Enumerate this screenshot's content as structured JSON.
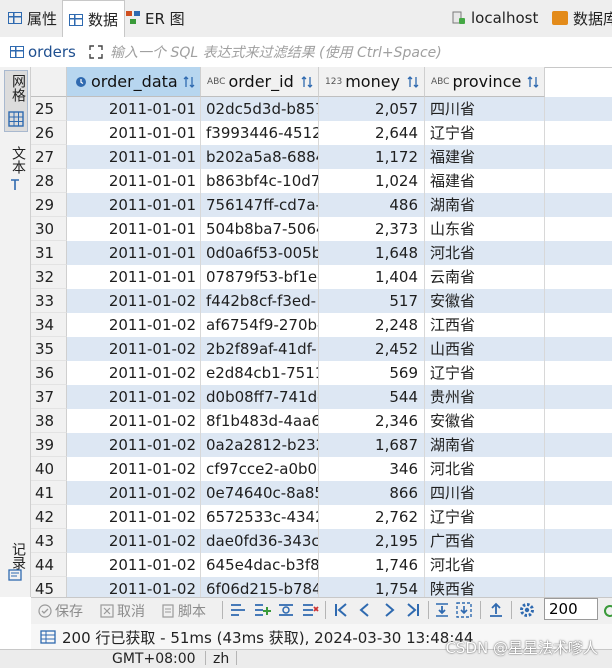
{
  "tabs": [
    {
      "label": "属性",
      "icon": "properties-table-icon"
    },
    {
      "label": "数据",
      "icon": "data-grid-icon",
      "active": true
    },
    {
      "label": "ER 图",
      "icon": "er-diagram-icon"
    }
  ],
  "connection": {
    "host": "localhost",
    "database_label": "数据库"
  },
  "filter": {
    "table": "orders",
    "placeholder": "输入一个 SQL 表达式来过滤结果 (使用 Ctrl+Space)"
  },
  "side_panels": [
    "网格",
    "文本",
    "记录"
  ],
  "columns": [
    {
      "name": "order_data",
      "type_badge": "🕑",
      "kind": "date"
    },
    {
      "name": "order_id",
      "type_badge": "ABC",
      "kind": "text"
    },
    {
      "name": "money",
      "type_badge": "123",
      "kind": "number"
    },
    {
      "name": "province",
      "type_badge": "ABC",
      "kind": "text"
    }
  ],
  "rows": [
    {
      "num": "25",
      "order_data": "2011-01-01",
      "order_id": "02dc5d3d-b857",
      "money": "2,057",
      "province": "四川省"
    },
    {
      "num": "26",
      "order_data": "2011-01-01",
      "order_id": "f3993446-4512",
      "money": "2,644",
      "province": "辽宁省"
    },
    {
      "num": "27",
      "order_data": "2011-01-01",
      "order_id": "b202a5a8-6884",
      "money": "1,172",
      "province": "福建省"
    },
    {
      "num": "28",
      "order_data": "2011-01-01",
      "order_id": "b863bf4c-10d7",
      "money": "1,024",
      "province": "福建省"
    },
    {
      "num": "29",
      "order_data": "2011-01-01",
      "order_id": "756147ff-cd7a-",
      "money": "486",
      "province": "湖南省"
    },
    {
      "num": "30",
      "order_data": "2011-01-01",
      "order_id": "504b8ba7-5064",
      "money": "2,373",
      "province": "山东省"
    },
    {
      "num": "31",
      "order_data": "2011-01-01",
      "order_id": "0d0a6f53-005b",
      "money": "1,648",
      "province": "河北省"
    },
    {
      "num": "32",
      "order_data": "2011-01-01",
      "order_id": "07879f53-bf1e-",
      "money": "1,404",
      "province": "云南省"
    },
    {
      "num": "33",
      "order_data": "2011-01-02",
      "order_id": "f442b8cf-f3ed-",
      "money": "517",
      "province": "安徽省"
    },
    {
      "num": "34",
      "order_data": "2011-01-02",
      "order_id": "af6754f9-270b-",
      "money": "2,248",
      "province": "江西省"
    },
    {
      "num": "35",
      "order_data": "2011-01-02",
      "order_id": "2b2f89af-41df-",
      "money": "2,452",
      "province": "山西省"
    },
    {
      "num": "36",
      "order_data": "2011-01-02",
      "order_id": "e2d84cb1-7511",
      "money": "569",
      "province": "辽宁省"
    },
    {
      "num": "37",
      "order_data": "2011-01-02",
      "order_id": "d0b08ff7-741d-",
      "money": "544",
      "province": "贵州省"
    },
    {
      "num": "38",
      "order_data": "2011-01-02",
      "order_id": "8f1b483d-4aa6",
      "money": "2,346",
      "province": "安徽省"
    },
    {
      "num": "39",
      "order_data": "2011-01-02",
      "order_id": "0a2a2812-b232",
      "money": "1,687",
      "province": "湖南省"
    },
    {
      "num": "40",
      "order_data": "2011-01-02",
      "order_id": "cf97cce2-a0b0-",
      "money": "346",
      "province": "河北省"
    },
    {
      "num": "41",
      "order_data": "2011-01-02",
      "order_id": "0e74640c-8a85",
      "money": "866",
      "province": "四川省"
    },
    {
      "num": "42",
      "order_data": "2011-01-02",
      "order_id": "6572533c-4342",
      "money": "2,762",
      "province": "辽宁省"
    },
    {
      "num": "43",
      "order_data": "2011-01-02",
      "order_id": "dae0fd36-343c-",
      "money": "2,195",
      "province": "广西省"
    },
    {
      "num": "44",
      "order_data": "2011-01-02",
      "order_id": "645e4dac-b3f8",
      "money": "1,746",
      "province": "河北省"
    },
    {
      "num": "45",
      "order_data": "2011-01-02",
      "order_id": "6f06d215-b784",
      "money": "1,754",
      "province": "陕西省"
    }
  ],
  "toolbar": {
    "save_label": "保存",
    "cancel_label": "取消",
    "script_label": "脚本",
    "fetch_size": "200"
  },
  "status": "200 行已获取 - 51ms (43ms 获取), 2024-03-30 13:48:44",
  "footer": {
    "timezone": "GMT+08:00",
    "locale": "zh"
  },
  "watermark": "CSDN @星星法术嗲人",
  "colors": {
    "selected_header": "#b7d6ef",
    "alt_row": "#dde7f3",
    "accent": "#2f6ab0"
  }
}
